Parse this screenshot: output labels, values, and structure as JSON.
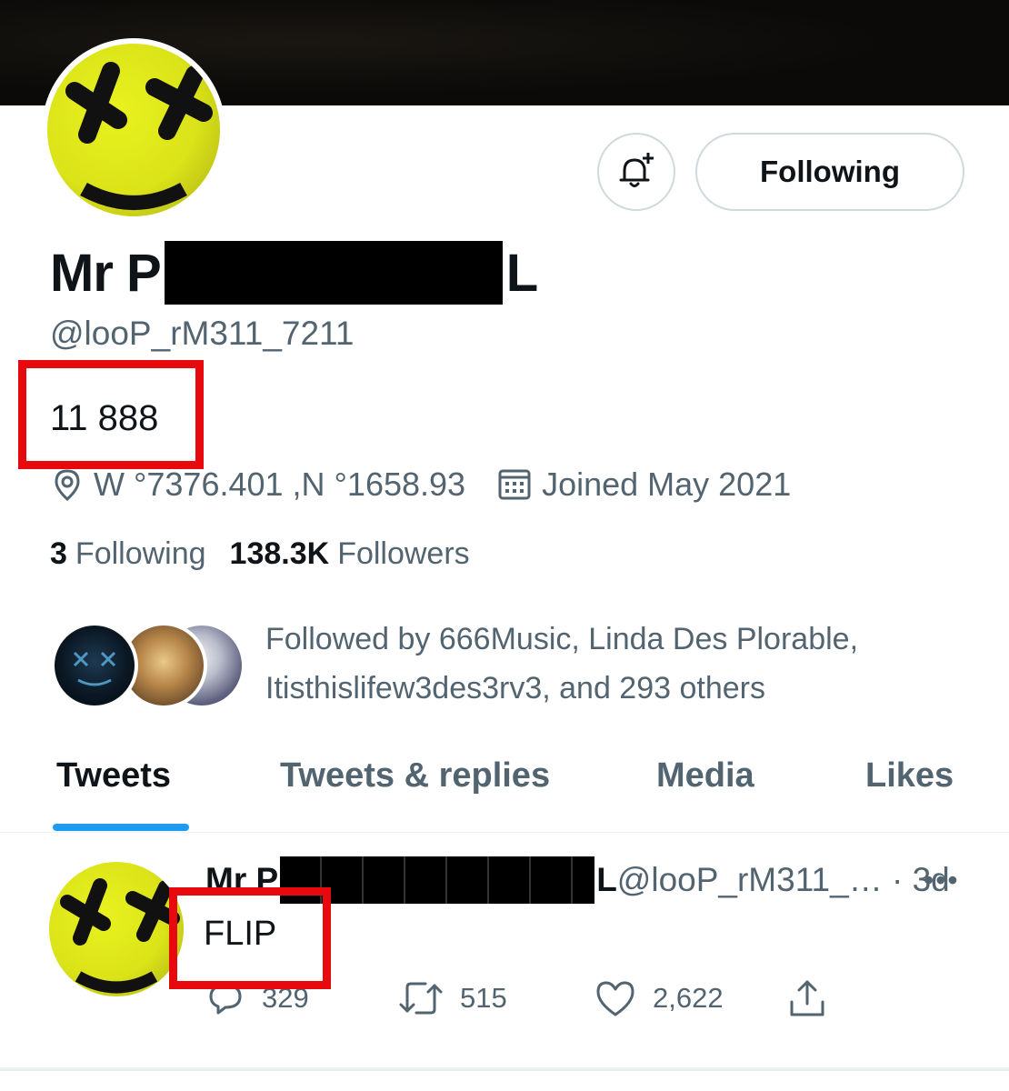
{
  "profile": {
    "name_prefix": "Mr P",
    "name_suffix": "L",
    "handle": "@looP_rM311_7211",
    "bio": "11 888",
    "location": "W °7376.401 ,N °1658.93",
    "joined": "Joined May 2021",
    "following_count": "3",
    "following_label": "Following",
    "followers_count": "138.3K",
    "followers_label": "Followers",
    "followed_by": "Followed by 666Music, Linda Des Plorable, Itisthislifew3des3rv3, and 293 others"
  },
  "actions": {
    "follow_button": "Following",
    "notify_icon": "bell-plus-icon"
  },
  "tabs": [
    {
      "label": "Tweets",
      "active": true
    },
    {
      "label": "Tweets & replies",
      "active": false
    },
    {
      "label": "Media",
      "active": false
    },
    {
      "label": "Likes",
      "active": false
    }
  ],
  "tweet": {
    "name_prefix": "Mr P",
    "name_suffix": "L",
    "handle_time": " @looP_rM311_… · 3d",
    "more": "•••",
    "text": "FLIP",
    "replies": "329",
    "retweets": "515",
    "likes": "2,622"
  },
  "colors": {
    "accent": "#1d9bf0",
    "annotation_red": "#e8090e",
    "avatar_yellow": "#dbe319"
  }
}
